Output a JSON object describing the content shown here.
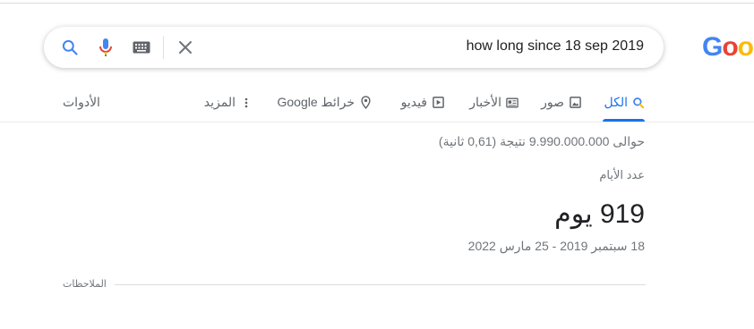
{
  "logo": {
    "letters": [
      "G",
      "o",
      "o"
    ]
  },
  "search": {
    "query": "how long since 18 sep 2019"
  },
  "tabs": [
    {
      "label": "الكل",
      "icon": "search-icon"
    },
    {
      "label": "صور",
      "icon": "image-icon"
    },
    {
      "label": "الأخبار",
      "icon": "news-icon"
    },
    {
      "label": "فيديو",
      "icon": "video-icon"
    },
    {
      "label": "خرائط Google",
      "icon": "map-pin-icon"
    },
    {
      "label": "المزيد",
      "icon": "more-vert-icon"
    }
  ],
  "tools_label": "الأدوات",
  "result_stats": "حوالى 9.990.000.000 نتيجة (0,61 ثانية)",
  "answer_card": {
    "title": "عدد الأيام",
    "value": "919 يوم",
    "range": "18 سبتمبر 2019 - 25 مارس 2022"
  },
  "notes_label": "الملاحظات",
  "colors": {
    "accent": "#1a73e8",
    "logo_blue": "#4285f4",
    "logo_red": "#ea4335",
    "logo_yellow": "#fbbc05"
  }
}
